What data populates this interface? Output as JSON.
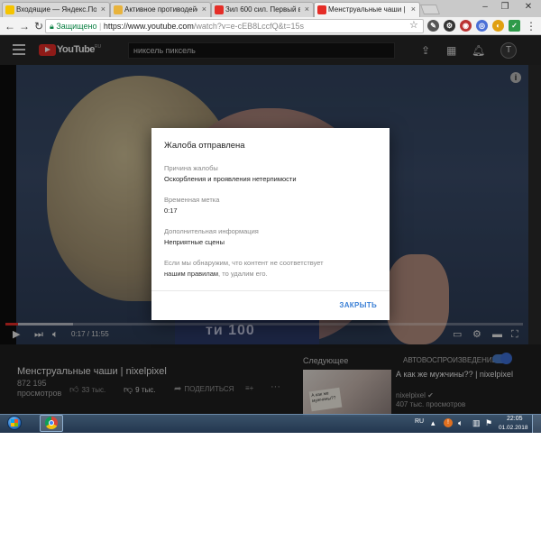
{
  "browser": {
    "tabs": [
      {
        "label": "Входящие — Яндекс.По",
        "favicon_color": "#f5c400"
      },
      {
        "label": "Активное противодейс",
        "favicon_color": "#e8b33c"
      },
      {
        "label": "Зил 600 сил. Первый вы",
        "favicon_color": "#e52d27"
      },
      {
        "label": "Менструальные чаши |",
        "favicon_color": "#e52d27"
      }
    ],
    "omnibox": {
      "secure_label": "Защищено",
      "url_host": "https://www.youtube.com",
      "url_rest": "/watch?v=e-cEB8LccfQ&t=15s"
    }
  },
  "youtube": {
    "logo_text": "YouTube",
    "logo_region": "RU",
    "search_query": "никсель пиксель",
    "avatar_letter": "T",
    "player": {
      "current_time": "0:17",
      "duration": "11:55",
      "time_display": "0:17 / 11:55",
      "shirt_text": "ти 100"
    },
    "video": {
      "title": "Менструальные чаши | nixelpixel",
      "views_count": "872 195",
      "views_label": "просмотров",
      "likes": "33 тыс.",
      "dislikes": "9 тыс.",
      "share_label": "ПОДЕЛИТЬСЯ"
    },
    "sidebar": {
      "up_next_label": "Следующее",
      "autoplay_label": "АВТОВОСПРОИЗВЕДЕНИЕ",
      "autoplay_on": true,
      "recommendation": {
        "title": "А как же мужчины?? | nixelpixel",
        "channel": "nixelpixel",
        "views": "407 тыс. просмотров",
        "thumb_text": "А как же мужчины??"
      }
    }
  },
  "dialog": {
    "title": "Жалоба отправлена",
    "reason_label": "Причина жалобы",
    "reason_value": "Оскорбления и проявления нетерпимости",
    "timestamp_label": "Временная метка",
    "timestamp_value": "0:17",
    "extra_label": "Дополнительная информация",
    "extra_value": "Неприятные сцены",
    "note_part1": "Если мы обнаружим, что контент не соответствует",
    "note_link": "нашим правилам",
    "note_part2": ", то удалим его.",
    "close_label": "ЗАКРЫТЬ"
  },
  "taskbar": {
    "language": "RU",
    "time": "22:05",
    "date": "01.02.2018"
  },
  "colors": {
    "youtube_red": "#e52d27",
    "dialog_link_blue": "#3a7fd5",
    "autoplay_blue": "#4a7bc8"
  }
}
